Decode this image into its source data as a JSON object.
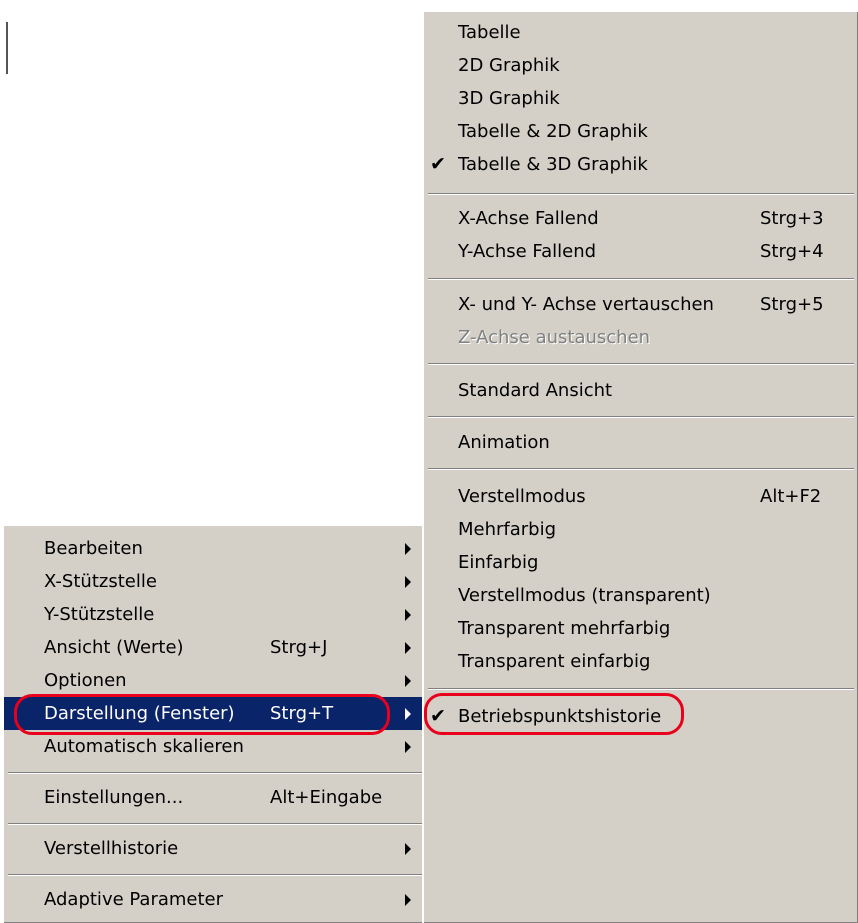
{
  "context_menu": {
    "items": [
      {
        "label": "Bearbeiten",
        "shortcut": "",
        "has_submenu": true
      },
      {
        "label": "X-Stützstelle",
        "shortcut": "",
        "has_submenu": true
      },
      {
        "label": "Y-Stützstelle",
        "shortcut": "",
        "has_submenu": true
      },
      {
        "label": "Ansicht (Werte)",
        "shortcut": "Strg+J",
        "has_submenu": true
      },
      {
        "label": "Optionen",
        "shortcut": "",
        "has_submenu": true
      },
      {
        "label": "Darstellung (Fenster)",
        "shortcut": "Strg+T",
        "has_submenu": true,
        "highlighted": true
      },
      {
        "label": "Automatisch skalieren",
        "shortcut": "",
        "has_submenu": true
      },
      {
        "label": "Einstellungen...",
        "shortcut": "Alt+Eingabe",
        "has_submenu": false
      },
      {
        "label": "Verstellhistorie",
        "shortcut": "",
        "has_submenu": true
      },
      {
        "label": "Adaptive Parameter",
        "shortcut": "",
        "has_submenu": true
      }
    ]
  },
  "submenu": {
    "items": [
      {
        "label": "Tabelle",
        "checked": false
      },
      {
        "label": "2D Graphik",
        "checked": false
      },
      {
        "label": "3D Graphik",
        "checked": false
      },
      {
        "label": "Tabelle & 2D Graphik",
        "checked": false
      },
      {
        "label": "Tabelle & 3D Graphik",
        "checked": true
      },
      {
        "label": "X-Achse Fallend",
        "shortcut": "Strg+3"
      },
      {
        "label": "Y-Achse Fallend",
        "shortcut": "Strg+4"
      },
      {
        "label": "X-  und Y- Achse vertauschen",
        "shortcut": "Strg+5"
      },
      {
        "label": "Z-Achse austauschen",
        "disabled": true
      },
      {
        "label": "Standard Ansicht"
      },
      {
        "label": "Animation"
      },
      {
        "label": "Verstellmodus",
        "shortcut": "Alt+F2"
      },
      {
        "label": "Mehrfarbig"
      },
      {
        "label": "Einfarbig"
      },
      {
        "label": "Verstellmodus (transparent)"
      },
      {
        "label": "Transparent mehrfarbig"
      },
      {
        "label": "Transparent einfarbig"
      },
      {
        "label": "Betriebspunktshistorie",
        "checked": true
      }
    ],
    "check_glyph": "✔"
  },
  "colors": {
    "menu_bg": "#d4d0c8",
    "highlight": "#0a246a",
    "annotation": "#e8001c"
  }
}
